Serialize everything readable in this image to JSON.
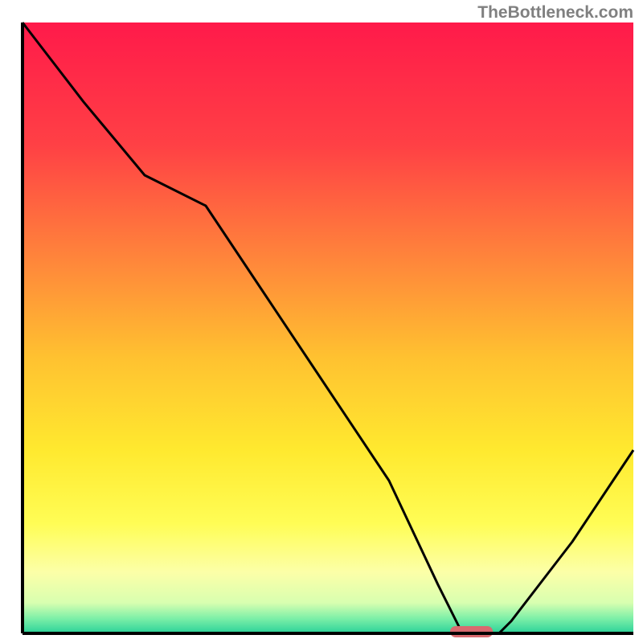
{
  "watermark": "TheBottleneck.com",
  "chart_data": {
    "type": "line",
    "title": "",
    "xlabel": "",
    "ylabel": "",
    "xlim": [
      0,
      100
    ],
    "ylim": [
      0,
      100
    ],
    "description": "Bottleneck curve over gradient background; valley indicates optimal pairing",
    "series": [
      {
        "name": "bottleneck-percentage",
        "x": [
          0,
          10,
          20,
          30,
          40,
          50,
          60,
          68,
          72,
          78,
          80,
          90,
          100
        ],
        "y": [
          100,
          87,
          75,
          70,
          55,
          40,
          25,
          8,
          0,
          0,
          2,
          15,
          30
        ]
      }
    ],
    "marker": {
      "x_range": [
        70,
        77
      ],
      "y": 0,
      "color": "#d96a6f"
    },
    "background_gradient": {
      "stops": [
        {
          "pos": 0.0,
          "color": "#ff1a4a"
        },
        {
          "pos": 0.2,
          "color": "#ff4045"
        },
        {
          "pos": 0.4,
          "color": "#ff8a3a"
        },
        {
          "pos": 0.55,
          "color": "#ffc230"
        },
        {
          "pos": 0.7,
          "color": "#ffe92f"
        },
        {
          "pos": 0.82,
          "color": "#fffd55"
        },
        {
          "pos": 0.9,
          "color": "#fcffa8"
        },
        {
          "pos": 0.95,
          "color": "#d8ffb0"
        },
        {
          "pos": 0.975,
          "color": "#7ff0a8"
        },
        {
          "pos": 1.0,
          "color": "#2ad199"
        }
      ]
    },
    "axes_stroke": "#000000"
  }
}
